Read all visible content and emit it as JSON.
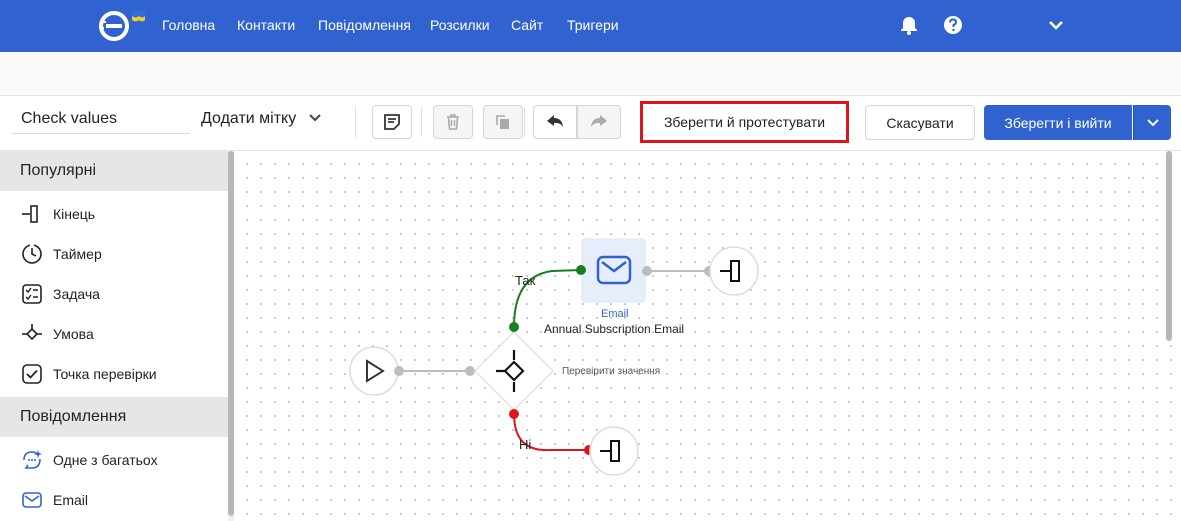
{
  "nav": {
    "items": [
      "Головна",
      "Контакти",
      "Повідомлення",
      "Розсилки",
      "Сайт",
      "Тригери"
    ],
    "brand_color": "#3063cf"
  },
  "toolbar": {
    "workflow_name": "Check values",
    "tag_label": "Додати мітку",
    "save_test_label": "Зберегти й протестувати",
    "cancel_label": "Скасувати",
    "save_exit_label": "Зберегти і вийти"
  },
  "sidebar": {
    "section_popular": "Популярні",
    "popular_items": [
      {
        "label": "Кінець",
        "icon": "end-node-icon"
      },
      {
        "label": "Таймер",
        "icon": "timer-icon"
      },
      {
        "label": "Задача",
        "icon": "task-icon"
      },
      {
        "label": "Умова",
        "icon": "condition-icon"
      },
      {
        "label": "Точка перевірки",
        "icon": "checkpoint-icon"
      }
    ],
    "section_messages": "Повідомлення",
    "message_items": [
      {
        "label": "Одне з багатьох",
        "icon": "one-of-many-icon"
      },
      {
        "label": "Email",
        "icon": "email-icon"
      }
    ]
  },
  "canvas": {
    "yes_label": "Так",
    "no_label": "Ні",
    "email_node_type": "Email",
    "email_node_title": "Annual Subscription Email",
    "condition_label": "Перевірити значення",
    "yes_color": "#16801f",
    "no_color": "#e0141c"
  }
}
